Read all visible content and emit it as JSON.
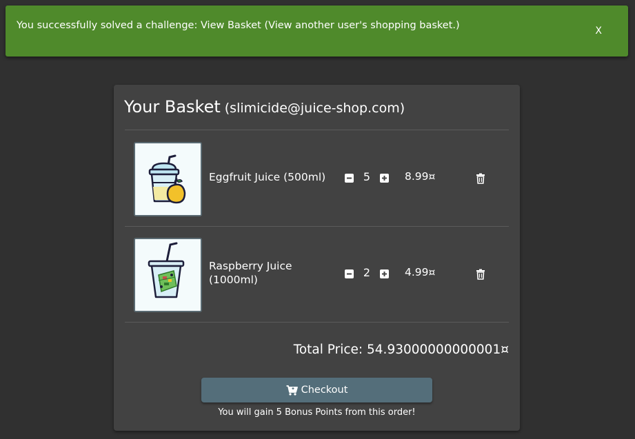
{
  "banner": {
    "message": "You successfully solved a challenge: View Basket (View another user's shopping basket.)",
    "close_label": "X",
    "color": "#4f8a2b"
  },
  "basket": {
    "title": "Your Basket",
    "owner": "(slimicide@juice-shop.com)",
    "items": [
      {
        "name": "Eggfruit Juice (500ml)",
        "quantity": "5",
        "price": "8.99¤",
        "image_icon": "eggfruit-juice-cup"
      },
      {
        "name": "Raspberry Juice (1000ml)",
        "quantity": "2",
        "price": "4.99¤",
        "image_icon": "raspberry-juice-cup"
      }
    ],
    "total": "Total Price: 54.93000000000001¤",
    "checkout_label": "Checkout",
    "bonus_text": "You will gain 5 Bonus Points from this order!"
  },
  "colors": {
    "background": "#303030",
    "card": "#424242",
    "checkout_button": "#546e7a"
  },
  "icons": [
    "minus-square-icon",
    "plus-square-icon",
    "trash-icon",
    "cart-plus-icon"
  ]
}
